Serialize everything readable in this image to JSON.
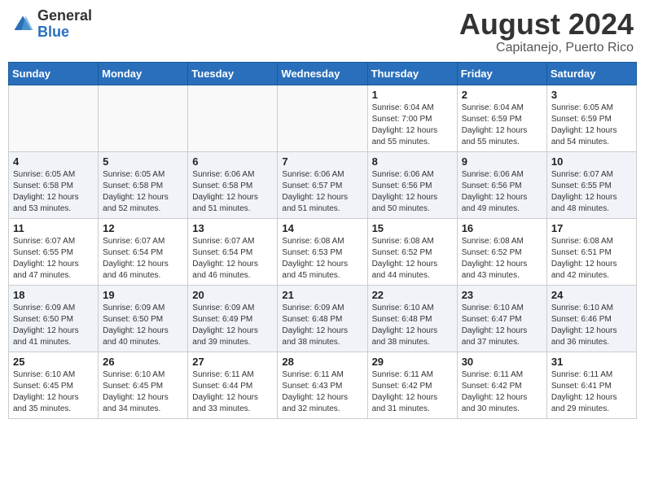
{
  "header": {
    "logo_general": "General",
    "logo_blue": "Blue",
    "month_year": "August 2024",
    "location": "Capitanejo, Puerto Rico"
  },
  "weekdays": [
    "Sunday",
    "Monday",
    "Tuesday",
    "Wednesday",
    "Thursday",
    "Friday",
    "Saturday"
  ],
  "weeks": [
    [
      {
        "day": "",
        "info": ""
      },
      {
        "day": "",
        "info": ""
      },
      {
        "day": "",
        "info": ""
      },
      {
        "day": "",
        "info": ""
      },
      {
        "day": "1",
        "info": "Sunrise: 6:04 AM\nSunset: 7:00 PM\nDaylight: 12 hours\nand 55 minutes."
      },
      {
        "day": "2",
        "info": "Sunrise: 6:04 AM\nSunset: 6:59 PM\nDaylight: 12 hours\nand 55 minutes."
      },
      {
        "day": "3",
        "info": "Sunrise: 6:05 AM\nSunset: 6:59 PM\nDaylight: 12 hours\nand 54 minutes."
      }
    ],
    [
      {
        "day": "4",
        "info": "Sunrise: 6:05 AM\nSunset: 6:58 PM\nDaylight: 12 hours\nand 53 minutes."
      },
      {
        "day": "5",
        "info": "Sunrise: 6:05 AM\nSunset: 6:58 PM\nDaylight: 12 hours\nand 52 minutes."
      },
      {
        "day": "6",
        "info": "Sunrise: 6:06 AM\nSunset: 6:58 PM\nDaylight: 12 hours\nand 51 minutes."
      },
      {
        "day": "7",
        "info": "Sunrise: 6:06 AM\nSunset: 6:57 PM\nDaylight: 12 hours\nand 51 minutes."
      },
      {
        "day": "8",
        "info": "Sunrise: 6:06 AM\nSunset: 6:56 PM\nDaylight: 12 hours\nand 50 minutes."
      },
      {
        "day": "9",
        "info": "Sunrise: 6:06 AM\nSunset: 6:56 PM\nDaylight: 12 hours\nand 49 minutes."
      },
      {
        "day": "10",
        "info": "Sunrise: 6:07 AM\nSunset: 6:55 PM\nDaylight: 12 hours\nand 48 minutes."
      }
    ],
    [
      {
        "day": "11",
        "info": "Sunrise: 6:07 AM\nSunset: 6:55 PM\nDaylight: 12 hours\nand 47 minutes."
      },
      {
        "day": "12",
        "info": "Sunrise: 6:07 AM\nSunset: 6:54 PM\nDaylight: 12 hours\nand 46 minutes."
      },
      {
        "day": "13",
        "info": "Sunrise: 6:07 AM\nSunset: 6:54 PM\nDaylight: 12 hours\nand 46 minutes."
      },
      {
        "day": "14",
        "info": "Sunrise: 6:08 AM\nSunset: 6:53 PM\nDaylight: 12 hours\nand 45 minutes."
      },
      {
        "day": "15",
        "info": "Sunrise: 6:08 AM\nSunset: 6:52 PM\nDaylight: 12 hours\nand 44 minutes."
      },
      {
        "day": "16",
        "info": "Sunrise: 6:08 AM\nSunset: 6:52 PM\nDaylight: 12 hours\nand 43 minutes."
      },
      {
        "day": "17",
        "info": "Sunrise: 6:08 AM\nSunset: 6:51 PM\nDaylight: 12 hours\nand 42 minutes."
      }
    ],
    [
      {
        "day": "18",
        "info": "Sunrise: 6:09 AM\nSunset: 6:50 PM\nDaylight: 12 hours\nand 41 minutes."
      },
      {
        "day": "19",
        "info": "Sunrise: 6:09 AM\nSunset: 6:50 PM\nDaylight: 12 hours\nand 40 minutes."
      },
      {
        "day": "20",
        "info": "Sunrise: 6:09 AM\nSunset: 6:49 PM\nDaylight: 12 hours\nand 39 minutes."
      },
      {
        "day": "21",
        "info": "Sunrise: 6:09 AM\nSunset: 6:48 PM\nDaylight: 12 hours\nand 38 minutes."
      },
      {
        "day": "22",
        "info": "Sunrise: 6:10 AM\nSunset: 6:48 PM\nDaylight: 12 hours\nand 38 minutes."
      },
      {
        "day": "23",
        "info": "Sunrise: 6:10 AM\nSunset: 6:47 PM\nDaylight: 12 hours\nand 37 minutes."
      },
      {
        "day": "24",
        "info": "Sunrise: 6:10 AM\nSunset: 6:46 PM\nDaylight: 12 hours\nand 36 minutes."
      }
    ],
    [
      {
        "day": "25",
        "info": "Sunrise: 6:10 AM\nSunset: 6:45 PM\nDaylight: 12 hours\nand 35 minutes."
      },
      {
        "day": "26",
        "info": "Sunrise: 6:10 AM\nSunset: 6:45 PM\nDaylight: 12 hours\nand 34 minutes."
      },
      {
        "day": "27",
        "info": "Sunrise: 6:11 AM\nSunset: 6:44 PM\nDaylight: 12 hours\nand 33 minutes."
      },
      {
        "day": "28",
        "info": "Sunrise: 6:11 AM\nSunset: 6:43 PM\nDaylight: 12 hours\nand 32 minutes."
      },
      {
        "day": "29",
        "info": "Sunrise: 6:11 AM\nSunset: 6:42 PM\nDaylight: 12 hours\nand 31 minutes."
      },
      {
        "day": "30",
        "info": "Sunrise: 6:11 AM\nSunset: 6:42 PM\nDaylight: 12 hours\nand 30 minutes."
      },
      {
        "day": "31",
        "info": "Sunrise: 6:11 AM\nSunset: 6:41 PM\nDaylight: 12 hours\nand 29 minutes."
      }
    ]
  ]
}
